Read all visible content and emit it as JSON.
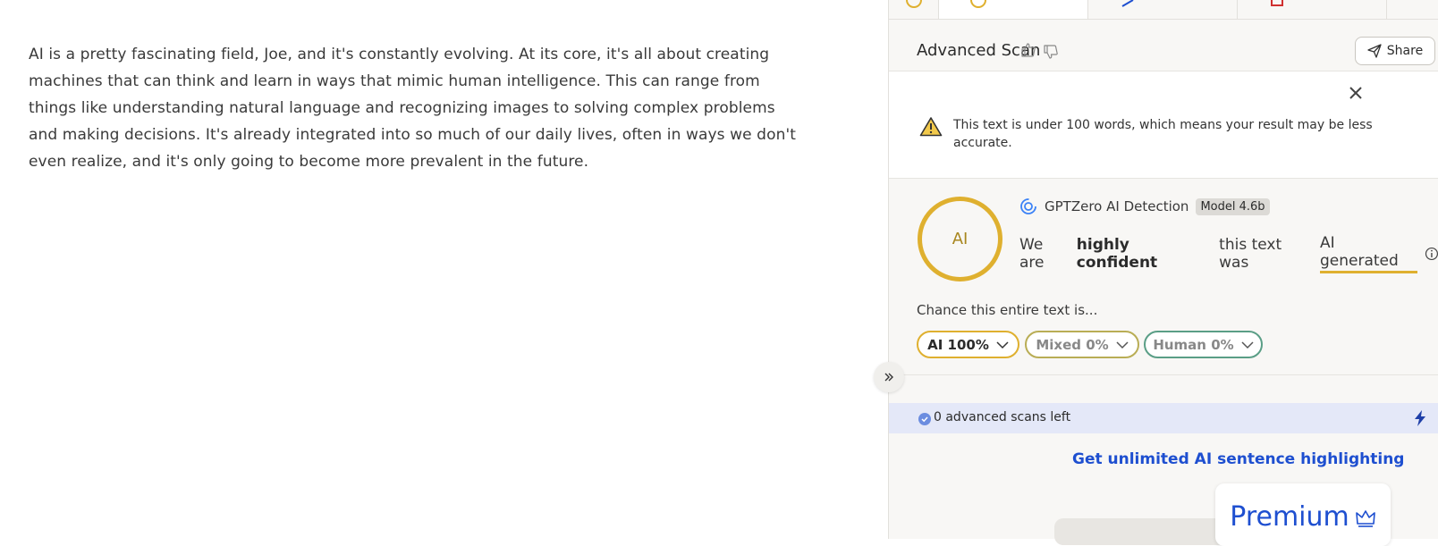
{
  "editor": {
    "text": "AI is a pretty fascinating field, Joe, and it's constantly evolving. At its core, it's all about creating machines that can think and learn in ways that mimic human intelligence. This can range from things like understanding natural language and recognizing images to solving complex problems and making decisions. It's already integrated into so much of our daily lives, often in ways we don't even realize, and it's only going to become more prevalent in the future."
  },
  "header": {
    "title": "Advanced Scan",
    "share_label": "Share"
  },
  "warning": {
    "text": "This text is under 100 words, which means your result may be less accurate."
  },
  "result": {
    "ring_label": "AI",
    "detector_name": "GPTZero AI Detection",
    "model": "Model 4.6b",
    "confidence_prefix": "We are",
    "confidence_level": "highly confident",
    "confidence_middle": "this text was",
    "classification": "AI generated",
    "chance_label": "Chance this entire text is...",
    "pills": [
      {
        "label": "AI 100%",
        "color": "#dfb02f"
      },
      {
        "label": "Mixed 0%",
        "color": "#b9ad55"
      },
      {
        "label": "Human 0%",
        "color": "#5a9e86"
      }
    ]
  },
  "scans": {
    "text": "0 advanced scans left"
  },
  "upgrade": {
    "link_label": "Get unlimited AI sentence highlighting",
    "premium_label": "Premium"
  },
  "colors": {
    "accent_ai": "#dfb02f",
    "link_blue": "#1e4fd0",
    "scans_bg": "#e4e8f8"
  }
}
